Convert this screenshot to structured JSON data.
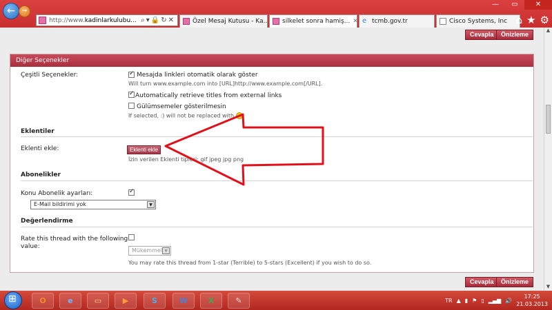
{
  "browser": {
    "address_prefix": "http://www.",
    "address_domain": "kadinlarkulubu...",
    "tabs": [
      {
        "label": "Özel Mesaj Kutusu - Ka...",
        "active": false
      },
      {
        "label": "silkelet sonra hamiş...",
        "active": true
      },
      {
        "label": "tcmb.gov.tr",
        "active": false
      },
      {
        "label": "Cisco Systems, Inc",
        "active": false
      }
    ]
  },
  "toolbar": {
    "reply_label": "Cevapla",
    "preview_label": "Önizleme"
  },
  "panel": {
    "title": "Diğer Seçenekler",
    "misc": {
      "label": "Çeşitli Seçenekler:",
      "opt1": "Mesajda linkleri otomatik olarak göster",
      "opt1_note": "Will turn www.example.com into [URL]http://www.example.com[/URL].",
      "opt2": "Automatically retrieve titles from external links",
      "opt3": "Gülümsemeler gösterilmesin",
      "opt3_note": "If selected, :) will not be replaced with"
    },
    "attachments": {
      "heading": "Eklentiler",
      "label": "Eklenti ekle:",
      "button": "Eklenti ekle",
      "note": "İzin verilen Eklenti tipleri: gif jpeg jpg png"
    },
    "subscriptions": {
      "heading": "Abonelikler",
      "label": "Konu Abonelik ayarları:",
      "select_value": "E-Mail bildirimi yok"
    },
    "rating": {
      "heading": "Değerlendirme",
      "label_line1": "Rate this thread with the following",
      "label_line2": "value:",
      "select_value": "Mükemmel",
      "note": "You may rate this thread from 1-star (Terrible) to 5-stars (Excellent) if you wish to do so."
    }
  },
  "taskbar": {
    "lang": "TR",
    "time": "17:25",
    "date": "21.03.2013",
    "apps": [
      "O",
      "e",
      "▭",
      "▶",
      "S",
      "W",
      "X",
      "✎"
    ]
  },
  "colors": {
    "accent": "#b8303f",
    "annotation": "#e0101a"
  }
}
